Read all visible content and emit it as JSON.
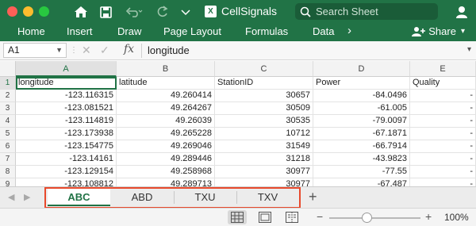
{
  "window": {
    "title": "CellSignals",
    "app_badge": "X"
  },
  "search": {
    "placeholder": "Search Sheet"
  },
  "ribbon": {
    "tabs": [
      "Home",
      "Insert",
      "Draw",
      "Page Layout",
      "Formulas",
      "Data"
    ],
    "share_label": "Share"
  },
  "formula_bar": {
    "name_box": "A1",
    "fx": "fx",
    "content": "longitude"
  },
  "grid": {
    "columns": [
      "A",
      "B",
      "C",
      "D",
      "E"
    ],
    "row_numbers": [
      "1",
      "2",
      "3",
      "4",
      "5",
      "6",
      "7",
      "8",
      "9"
    ],
    "rows": [
      [
        "longitude",
        "latitude",
        "StationID",
        "Power",
        "Quality"
      ],
      [
        "-123.116315",
        "49.260414",
        "30657",
        "-84.0496",
        "-"
      ],
      [
        "-123.081521",
        "49.264267",
        "30509",
        "-61.005",
        "-"
      ],
      [
        "-123.114819",
        "49.26039",
        "30535",
        "-79.0097",
        "-"
      ],
      [
        "-123.173938",
        "49.265228",
        "10712",
        "-67.1871",
        "-"
      ],
      [
        "-123.154775",
        "49.269046",
        "31549",
        "-66.7914",
        "-"
      ],
      [
        "-123.14161",
        "49.289446",
        "31218",
        "-43.9823",
        "-"
      ],
      [
        "-123.129154",
        "49.258968",
        "30977",
        "-77.55",
        "-"
      ],
      [
        "-123.108812",
        "49.289713",
        "30977",
        "-67.487",
        "-"
      ]
    ]
  },
  "sheets": {
    "tabs": [
      "ABC",
      "ABD",
      "TXU",
      "TXV"
    ],
    "active": "ABC",
    "add_label": "+"
  },
  "status": {
    "zoom": "100%",
    "zoom_level_percent": 100
  },
  "colors": {
    "accent": "#217346",
    "highlight": "#e8492c"
  }
}
